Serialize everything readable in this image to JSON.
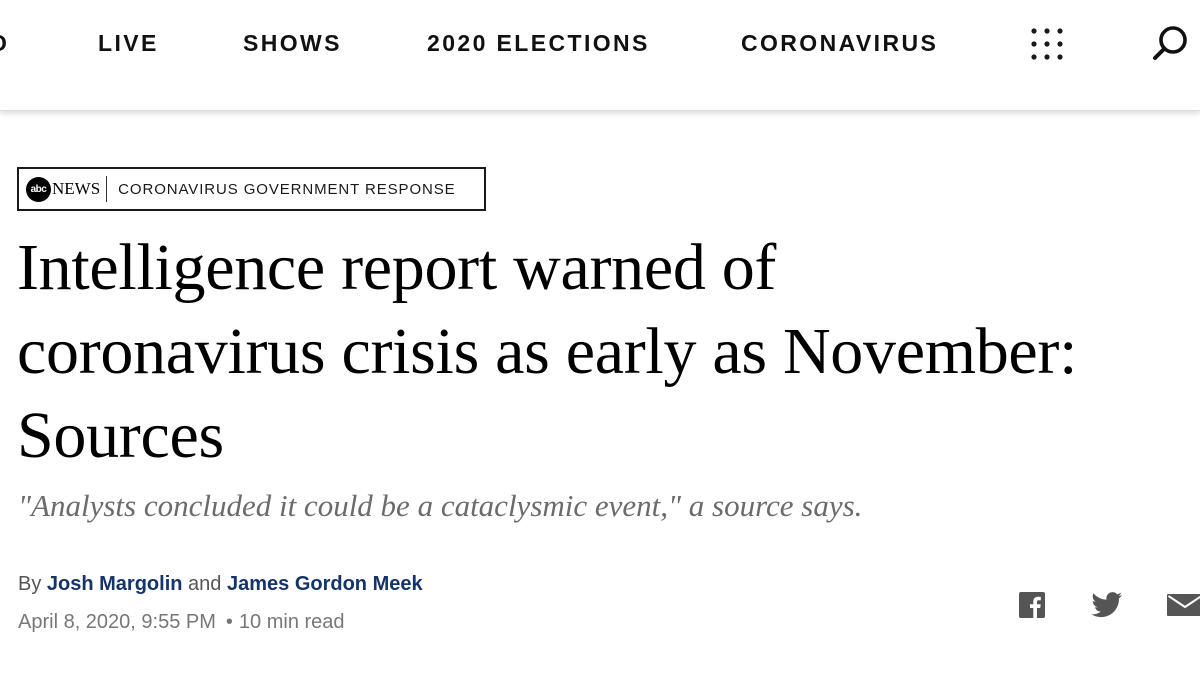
{
  "nav": {
    "cut_item": "O",
    "items": [
      {
        "label": "LIVE"
      },
      {
        "label": "SHOWS"
      },
      {
        "label": "2020 ELECTIONS"
      },
      {
        "label": "CORONAVIRUS"
      }
    ],
    "menu_icon": "grid-dots-icon",
    "search_icon": "search-icon"
  },
  "badge": {
    "logo_abc": "abc",
    "logo_news": "NEWS",
    "section": "CORONAVIRUS GOVERNMENT RESPONSE"
  },
  "article": {
    "headline_lines": [
      "Intelligence report warned of",
      "coronavirus crisis as early as November:",
      "Sources"
    ],
    "dek": "\"Analysts concluded it could be a cataclysmic event,\" a source says.",
    "byline": {
      "prefix": "By",
      "author1": "Josh Margolin",
      "joiner": "and",
      "author2": "James Gordon Meek"
    },
    "date": "April 8, 2020, 9:55 PM",
    "separator": "•",
    "read_time": "10 min read"
  },
  "share": {
    "icons": [
      "facebook-icon",
      "twitter-icon",
      "email-icon"
    ]
  },
  "colors": {
    "author_link": "#14346b",
    "dek_gray": "#6b6b6b",
    "meta_gray": "#777777",
    "icon_gray": "#555555"
  }
}
